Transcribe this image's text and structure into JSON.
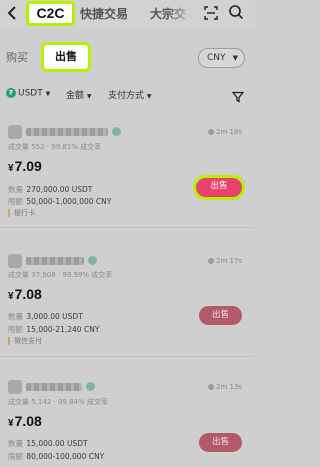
{
  "header": {
    "back_icon": "chevron-left-icon",
    "tabs": [
      "C2C",
      "快捷交易",
      "大宗交"
    ],
    "scan_icon": "scan-icon",
    "search_icon": "search-icon"
  },
  "subheader": {
    "buy_label": "购买",
    "sell_label": "出售",
    "currency": "CNY",
    "currency_caret": "▼"
  },
  "filters": {
    "coin": "USDT",
    "coin_caret": "▼",
    "amount": "金额",
    "amount_caret": "▼",
    "payment": "支付方式",
    "payment_caret": "▼",
    "tether_symbol": "₮"
  },
  "listings": [
    {
      "time": "2m 18s",
      "stats": "成交量 552  ·  99.81% 成交率",
      "currency_symbol": "¥",
      "price": "7.09",
      "qty_label": "数量",
      "qty": "270,000.00 USDT",
      "limit_label": "限额",
      "limit": "50,000-1,000,000 CNY",
      "payment": "银行卡",
      "button": "出售"
    },
    {
      "time": "2m 17s",
      "stats": "成交量 37,908  ·  99.99% 成交率",
      "currency_symbol": "¥",
      "price": "7.08",
      "qty_label": "数量",
      "qty": "3,000.00 USDT",
      "limit_label": "限额",
      "limit": "15,000-21,240 CNY",
      "payment": "微信支付",
      "button": "出售"
    },
    {
      "time": "2m 13s",
      "stats": "成交量 5,142  ·  99.84% 成交率",
      "currency_symbol": "¥",
      "price": "7.08",
      "qty_label": "数量",
      "qty": "15,000.00 USDT",
      "limit_label": "限额",
      "limit": "80,000-100,000 CNY",
      "payment": "",
      "button": "出售"
    }
  ]
}
